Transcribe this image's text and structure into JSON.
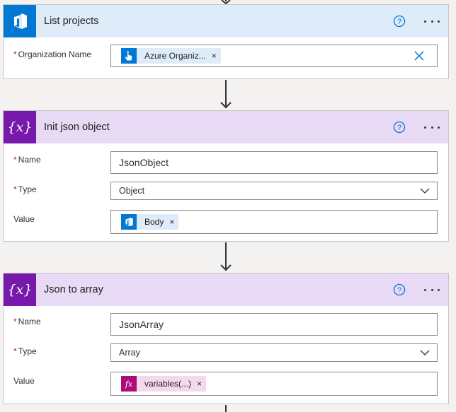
{
  "colors": {
    "devops_header_bg": "#deecf9",
    "devops_icon_bg": "#0078d4",
    "variable_header_bg": "#e8d9f4",
    "variable_icon_bg": "#7719aa",
    "token_devops_bg": "#deecf9",
    "token_expression_bg": "#f4d9ec",
    "expression_icon_bg": "#ad0a7a"
  },
  "cards": {
    "list_projects": {
      "title": "List projects",
      "icon": "azure-devops-icon",
      "fields": {
        "organization": {
          "label": "Organization Name",
          "required_mark": "*",
          "token_label": "Azure Organiz...",
          "token_icon": "hand-pointer-icon",
          "token_remove": "×"
        }
      }
    },
    "init_json": {
      "title": "Init json object",
      "icon": "variable-icon",
      "fields": {
        "name": {
          "label": "Name",
          "required_mark": "*",
          "value": "JsonObject"
        },
        "type": {
          "label": "Type",
          "required_mark": "*",
          "value": "Object"
        },
        "value": {
          "label": "Value",
          "token_label": "Body",
          "token_icon": "azure-devops-icon",
          "token_remove": "×"
        }
      }
    },
    "json_to_array": {
      "title": "Json to array",
      "icon": "variable-icon",
      "fields": {
        "name": {
          "label": "Name",
          "required_mark": "*",
          "value": "JsonArray"
        },
        "type": {
          "label": "Type",
          "required_mark": "*",
          "value": "Array"
        },
        "value": {
          "label": "Value",
          "token_label": "variables(...)",
          "token_icon": "fx-expression-icon",
          "token_remove": "×"
        }
      }
    }
  }
}
